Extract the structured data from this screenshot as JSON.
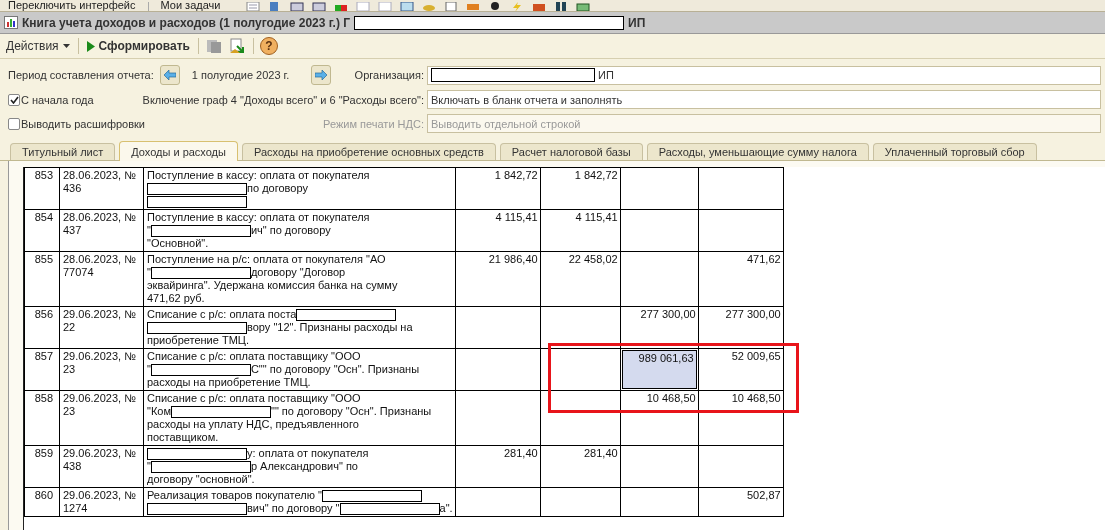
{
  "top_toolbar": {
    "buttons": [
      "Переключить интерфейс",
      "Мои задачи"
    ]
  },
  "window": {
    "title": "Книга учета доходов и расходов (1 полугодие 2023 г.) Г",
    "title_suffix": "ИП"
  },
  "actions": {
    "menu": "Действия",
    "run_button": "Сформировать",
    "help": "?"
  },
  "form": {
    "period_label": "Период составления отчета:",
    "period_value": "1 полугодие 2023 г.",
    "org_label": "Организация:",
    "org_value": "ИП",
    "from_year": {
      "label": "С начала года",
      "checked": true
    },
    "include_label": "Включение граф 4 \"Доходы всего\" и 6 \"Расходы всего\":",
    "include_value": "Включать в бланк отчета и заполнять",
    "details": {
      "label": "Выводить расшифровки",
      "checked": false
    },
    "vat_label": "Режим печати НДС:",
    "vat_value": "Выводить отдельной строкой",
    "vat_disabled": true
  },
  "tabs": [
    {
      "label": "Титульный лист",
      "selected": false
    },
    {
      "label": "Доходы и расходы",
      "selected": true
    },
    {
      "label": "Расходы на приобретение основных средств",
      "selected": false
    },
    {
      "label": "Расчет налоговой базы",
      "selected": false
    },
    {
      "label": "Расходы, уменьшающие сумму налога",
      "selected": false
    },
    {
      "label": "Уплаченный торговый сбор",
      "selected": false
    }
  ],
  "table": {
    "rows": [
      {
        "number": "853",
        "document": "28.06.2023, № 436",
        "lines": [
          [
            {
              "kind": "text",
              "text": "Поступление в кассу: оплата от покупателя"
            }
          ],
          [
            {
              "kind": "redacted"
            },
            {
              "kind": "text",
              "text": "по договору"
            }
          ],
          [
            {
              "kind": "redacted"
            }
          ]
        ],
        "amounts": [
          {
            "text": "1 842,72",
            "selected": false
          },
          {
            "text": "1 842,72",
            "selected": false
          },
          {
            "selected": false
          },
          {
            "selected": false
          }
        ]
      },
      {
        "number": "854",
        "document": "28.06.2023, № 437",
        "lines": [
          [
            {
              "kind": "text",
              "text": "Поступление в кассу: оплата от покупателя"
            }
          ],
          [
            {
              "kind": "text",
              "text": "\""
            },
            {
              "kind": "redacted"
            },
            {
              "kind": "text",
              "text": "ич\" по договору"
            }
          ],
          [
            {
              "kind": "text",
              "text": "\"Основной\"."
            }
          ]
        ],
        "amounts": [
          {
            "text": "4 115,41",
            "selected": false
          },
          {
            "text": "4 115,41",
            "selected": false
          },
          {
            "selected": false
          },
          {
            "selected": false
          }
        ]
      },
      {
        "number": "855",
        "document": "28.06.2023, № 77074",
        "lines": [
          [
            {
              "kind": "text",
              "text": "Поступление на р/с: оплата от покупателя \"АО"
            }
          ],
          [
            {
              "kind": "text",
              "text": "\""
            },
            {
              "kind": "redacted"
            },
            {
              "kind": "text",
              "text": "договору \"Договор"
            }
          ],
          [
            {
              "kind": "text",
              "text": "эквайринга\". Удержана комиссия банка на сумму"
            }
          ],
          [
            {
              "kind": "text",
              "text": "471,62 руб."
            }
          ]
        ],
        "amounts": [
          {
            "text": "21 986,40",
            "selected": false
          },
          {
            "text": "22 458,02",
            "selected": false
          },
          {
            "selected": false
          },
          {
            "text": "471,62",
            "selected": false
          }
        ]
      },
      {
        "number": "856",
        "document": "29.06.2023, № 22",
        "lines": [
          [
            {
              "kind": "text",
              "text": "Списание с р/с: оплата поста"
            },
            {
              "kind": "redacted"
            }
          ],
          [
            {
              "kind": "redacted"
            },
            {
              "kind": "text",
              "text": "вору \"12\". Признаны расходы на"
            }
          ],
          [
            {
              "kind": "text",
              "text": "приобретение ТМЦ."
            }
          ]
        ],
        "amounts": [
          {
            "selected": false
          },
          {
            "selected": false
          },
          {
            "text": "277 300,00",
            "selected": false
          },
          {
            "text": "277 300,00",
            "selected": false
          }
        ]
      },
      {
        "number": "857",
        "document": "29.06.2023, № 23",
        "lines": [
          [
            {
              "kind": "text",
              "text": "Списание с р/с: оплата поставщику \"ООО"
            }
          ],
          [
            {
              "kind": "text",
              "text": "\""
            },
            {
              "kind": "redacted"
            },
            {
              "kind": "text",
              "text": "С\"\" по договору \"Осн\". Признаны"
            }
          ],
          [
            {
              "kind": "text",
              "text": "расходы на приобретение ТМЦ."
            }
          ]
        ],
        "amounts": [
          {
            "selected": false
          },
          {
            "selected": false
          },
          {
            "text": "989 061,63",
            "selected": true
          },
          {
            "text": "52 009,65",
            "selected": false
          }
        ]
      },
      {
        "number": "858",
        "document": "29.06.2023, № 23",
        "lines": [
          [
            {
              "kind": "text",
              "text": "Списание с р/с: оплата поставщику \"ООО"
            }
          ],
          [
            {
              "kind": "text",
              "text": "\"Ком"
            },
            {
              "kind": "redacted"
            },
            {
              "kind": "text",
              "text": "\"\" по договору \"Осн\". Признаны"
            }
          ],
          [
            {
              "kind": "text",
              "text": "расходы на уплату НДС, предъявленного"
            }
          ],
          [
            {
              "kind": "text",
              "text": "поставщиком."
            }
          ]
        ],
        "amounts": [
          {
            "selected": false
          },
          {
            "selected": false
          },
          {
            "text": "10 468,50",
            "selected": false
          },
          {
            "text": "10 468,50",
            "selected": false
          }
        ]
      },
      {
        "number": "859",
        "document": "29.06.2023, № 438",
        "lines": [
          [
            {
              "kind": "redacted"
            },
            {
              "kind": "text",
              "text": "у: оплата от покупателя"
            }
          ],
          [
            {
              "kind": "text",
              "text": "\""
            },
            {
              "kind": "redacted"
            },
            {
              "kind": "text",
              "text": "р Александрович\" по"
            }
          ],
          [
            {
              "kind": "text",
              "text": "договору \"основной\"."
            }
          ]
        ],
        "amounts": [
          {
            "text": "281,40",
            "selected": false
          },
          {
            "text": "281,40",
            "selected": false
          },
          {
            "selected": false
          },
          {
            "selected": false
          }
        ]
      },
      {
        "number": "860",
        "document": "29.06.2023, № 1274",
        "lines": [
          [
            {
              "kind": "text",
              "text": "Реализация товаров покупателю \""
            },
            {
              "kind": "redacted"
            }
          ],
          [
            {
              "kind": "redacted"
            },
            {
              "kind": "text",
              "text": "вич\" по договору \""
            },
            {
              "kind": "redacted"
            },
            {
              "kind": "text",
              "text": "а\"."
            }
          ]
        ],
        "amounts": [
          {
            "selected": false
          },
          {
            "selected": false
          },
          {
            "selected": false
          },
          {
            "text": "502,87",
            "selected": false
          }
        ]
      }
    ]
  }
}
